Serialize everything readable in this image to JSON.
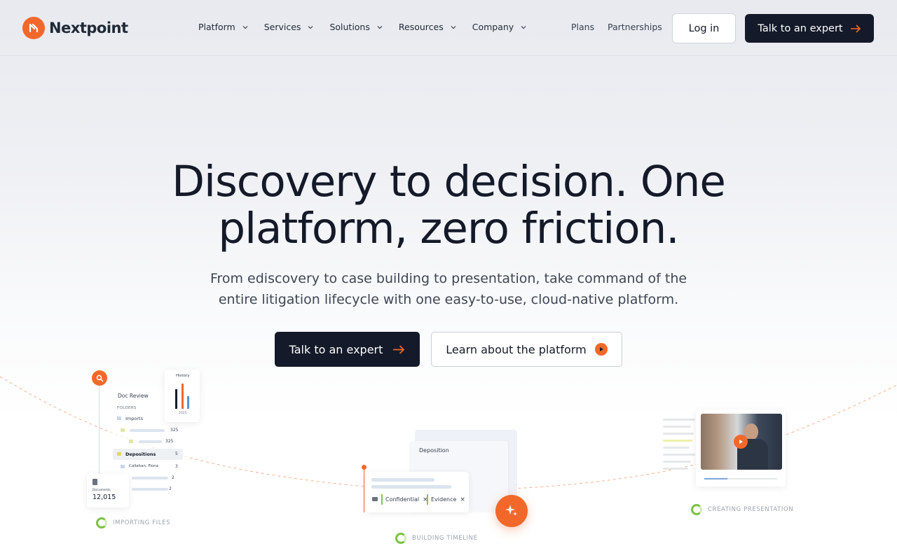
{
  "brand": {
    "name": "Nextpoint"
  },
  "nav": {
    "items": [
      {
        "label": "Platform"
      },
      {
        "label": "Services"
      },
      {
        "label": "Solutions"
      },
      {
        "label": "Resources"
      },
      {
        "label": "Company"
      }
    ],
    "plans": "Plans",
    "partnerships": "Partnerships",
    "login": "Log in",
    "cta": "Talk to an expert"
  },
  "hero": {
    "headline_line1": "Discovery to decision. One",
    "headline_line2": "platform, zero friction.",
    "sub_line1": "From ediscovery to case building to presentation, take command of the",
    "sub_line2": "entire litigation lifecycle with one easy-to-use, cloud-native platform.",
    "cta_primary": "Talk to an expert",
    "cta_secondary": "Learn about the platform"
  },
  "illustration": {
    "doc_review": {
      "title": "Doc Review",
      "folders_label": "FOLDERS",
      "imports": "Imports",
      "count_a": "325",
      "count_b": "325",
      "depositions": "Depositions",
      "depositions_count": "5",
      "person": "Callahan, Fiona",
      "person_count": "3",
      "row_count_a": "2",
      "row_count_b": "2",
      "history_title": "History",
      "history_year": "2025",
      "documents_label": "Documents",
      "documents_count": "12,015",
      "status": "IMPORTING FILES"
    },
    "timeline": {
      "title": "Deposition",
      "tag_confidential": "Confidential",
      "tag_evidence": "Evidence",
      "status": "BUILDING TIMELINE"
    },
    "presentation": {
      "status": "CREATING PRESENTATION"
    },
    "colors": {
      "accent": "#f2682a",
      "dark": "#141a29",
      "green": "#7cc242"
    }
  }
}
